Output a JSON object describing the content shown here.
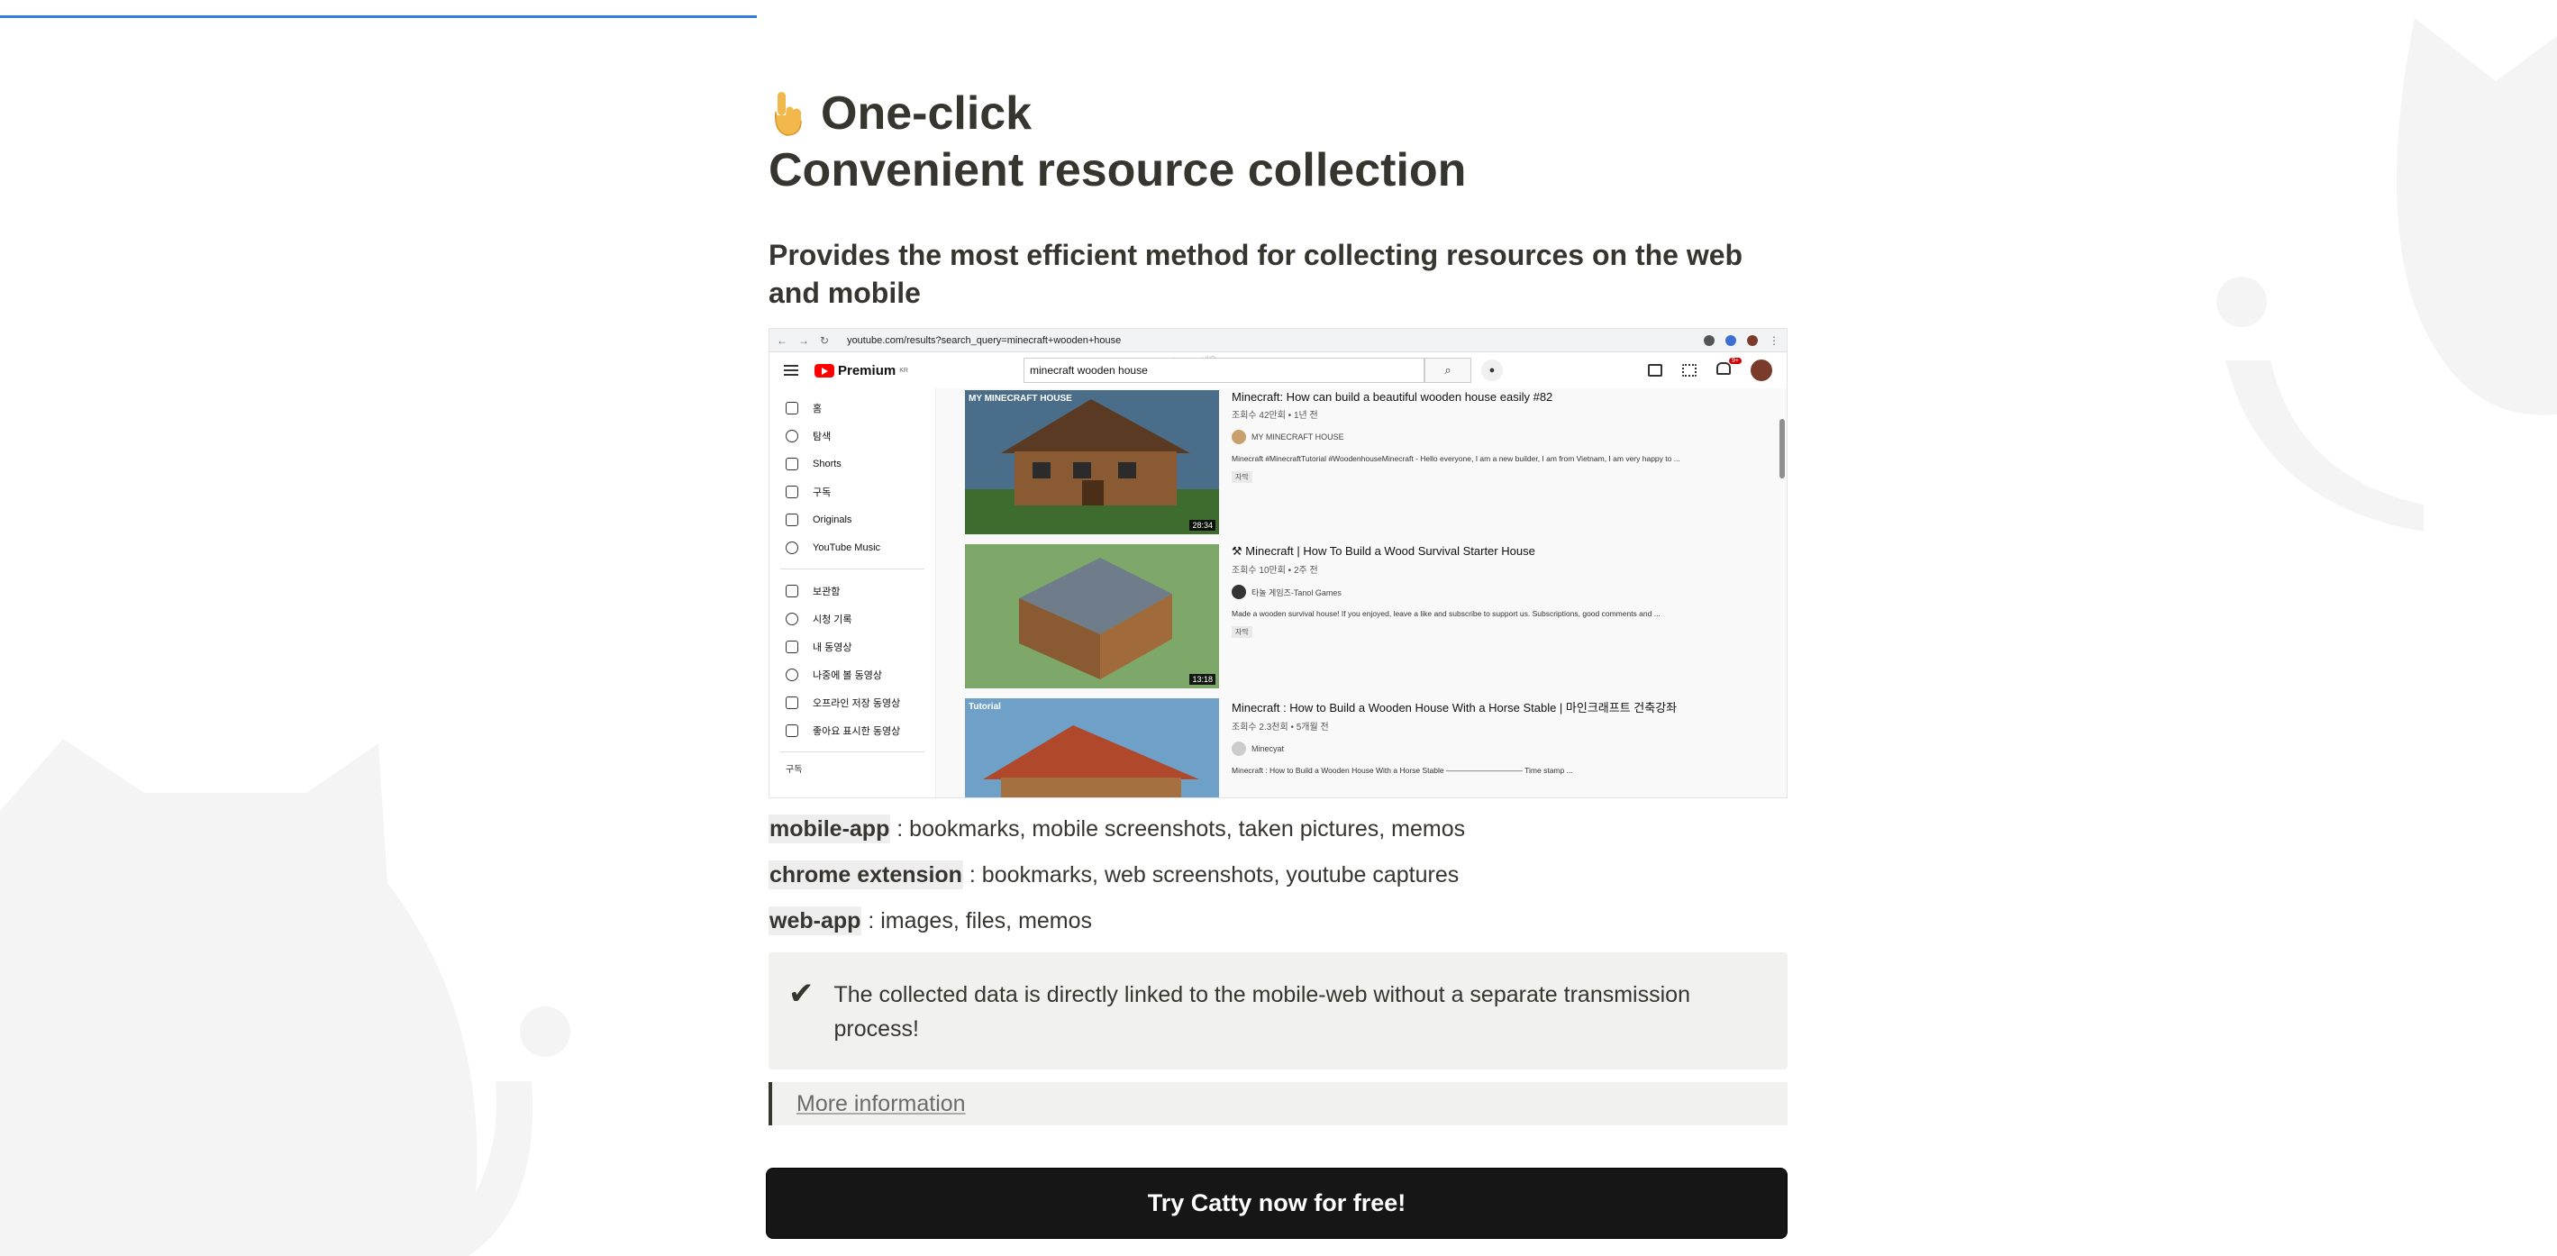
{
  "hero": {
    "line1": "One-click",
    "line2": "Convenient resource collection",
    "subtitle": "Provides the most efficient method for collecting resources on the web and mobile"
  },
  "screenshot": {
    "url": "youtube.com/results?search_query=minecraft+wooden+house",
    "logo": "Premium",
    "logo_region": "KR",
    "search_value": "minecraft wooden house",
    "ghost_text": "www.youtube.com 내용",
    "notif_count": "9+",
    "sidebar": [
      "홈",
      "탐색",
      "Shorts",
      "구독",
      "Originals",
      "YouTube Music"
    ],
    "sidebar2": [
      "보관함",
      "시청 기록",
      "내 동영상",
      "나중에 볼 동영상",
      "오프라인 저장 동영상",
      "좋아요 표시한 동영상"
    ],
    "sidebar_footer": "구독",
    "videos": [
      {
        "title": "Minecraft: How can build a beautiful wooden house easily #82",
        "meta": "조회수 42만회 • 1년 전",
        "channel": "MY MINECRAFT HOUSE",
        "desc": "Minecraft #MinecraftTutorial #WoodenhouseMinecraft - Hello everyone, I am a new builder, I am from Vietnam, I am very happy to ...",
        "badge": "자막",
        "duration": "28:34",
        "tag": "MY MINECRAFT HOUSE"
      },
      {
        "title": "⚒ Minecraft | How To Build a Wood Survival Starter House",
        "meta": "조회수 10만회 • 2주 전",
        "channel": "타놀 게임즈-Tanol Games",
        "desc": "Made a wooden survival house! If you enjoyed, leave a like and subscribe to support us. Subscriptions, good comments and ...",
        "badge": "자막",
        "duration": "13:18",
        "tag": ""
      },
      {
        "title": "Minecraft : How to Build a Wooden House With a Horse Stable | 마인크래프트 건축강좌",
        "meta": "조회수 2.3천회 • 5개월 전",
        "channel": "Minecyat",
        "desc": "Minecraft : How to Build a Wooden House With a Horse Stable —————————— Time stamp ...",
        "badge": "",
        "duration": "",
        "tag": "Tutorial"
      }
    ]
  },
  "features": [
    {
      "key": "mobile-app",
      "text": " : bookmarks, mobile screenshots, taken pictures, memos"
    },
    {
      "key": "chrome extension",
      "text": " : bookmarks, web screenshots, youtube captures"
    },
    {
      "key": "web-app",
      "text": " : images, files, memos"
    }
  ],
  "callout": {
    "icon": "✔",
    "text": "The collected data is directly linked to the mobile-web without a separate transmission process!"
  },
  "more_link": "More information",
  "cta": "Try Catty now for free!",
  "colors": {
    "progress": "#2f7fd8",
    "cta_bg": "#161616",
    "text": "#37352f",
    "callout_bg": "#f1f1ef"
  }
}
